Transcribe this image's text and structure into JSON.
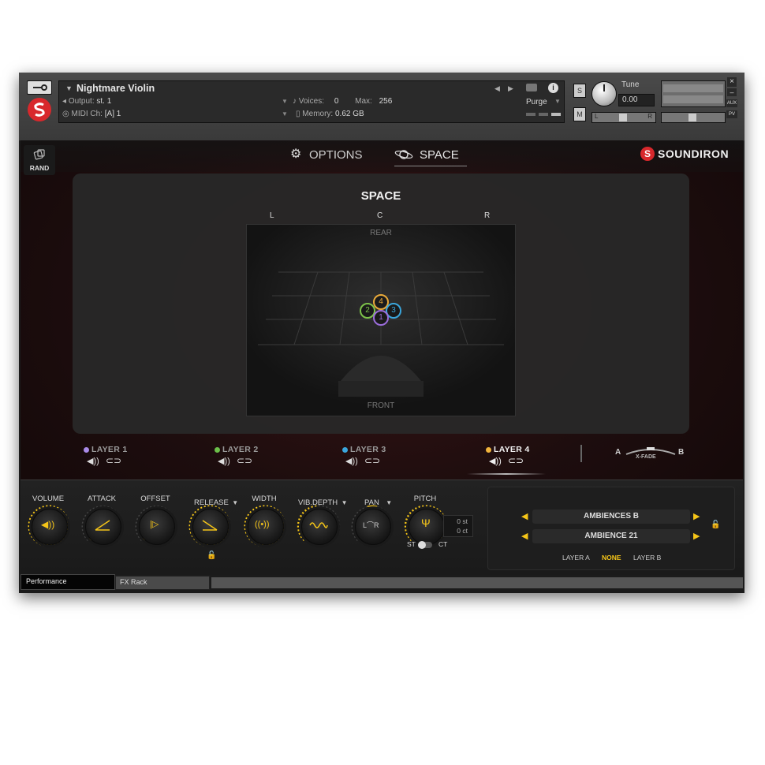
{
  "header": {
    "instrument_name": "Nightmare Violin",
    "output_label": "Output:",
    "output_value": "st. 1",
    "midi_label": "MIDI Ch:",
    "midi_value": "[A] 1",
    "voices_label": "Voices:",
    "voices_value": "0",
    "max_label": "Max:",
    "max_value": "256",
    "memory_label": "Memory:",
    "memory_value": "0.62 GB",
    "purge_label": "Purge",
    "tune_label": "Tune",
    "tune_value": "0.00",
    "solo_label": "S",
    "mute_label": "M",
    "pan_l": "L",
    "pan_r": "R",
    "aux_label": "AUX",
    "pv_label": "PV",
    "close_label": "×",
    "min_label": "–"
  },
  "nav": {
    "rand_label": "RAND",
    "options_tab": "OPTIONS",
    "space_tab": "SPACE",
    "brand": "SOUNDIRON"
  },
  "space": {
    "title": "SPACE",
    "label_l": "L",
    "label_c": "C",
    "label_r": "R",
    "rear": "REAR",
    "front": "FRONT",
    "nodes": [
      {
        "label": "4",
        "color": "#e8a93a"
      },
      {
        "label": "2",
        "color": "#7dc24a"
      },
      {
        "label": "3",
        "color": "#3aa6dd"
      },
      {
        "label": "1",
        "color": "#9b6ddb"
      }
    ]
  },
  "layers": [
    {
      "label": "LAYER 1",
      "color": "#a98be8",
      "active": false
    },
    {
      "label": "LAYER 2",
      "color": "#6cc04a",
      "active": false
    },
    {
      "label": "LAYER 3",
      "color": "#3aa6dd",
      "active": false
    },
    {
      "label": "LAYER 4",
      "color": "#f1b43c",
      "active": true
    }
  ],
  "xfade": {
    "a": "A",
    "b": "B",
    "label": "X-FADE"
  },
  "controls": {
    "volume": "VOLUME",
    "attack": "ATTACK",
    "offset": "OFFSET",
    "release": "RELEASE",
    "width": "WIDTH",
    "vib_depth": "VIB.DEPTH",
    "pan": "PAN",
    "pitch": "PITCH",
    "pitch_st": "0 st",
    "pitch_ct": "0 ct",
    "st": "ST",
    "ct": "CT"
  },
  "ambience": {
    "preset_1": "AMBIENCES B",
    "preset_2": "AMBIENCE 21",
    "layer_a": "LAYER A",
    "none": "NONE",
    "layer_b": "LAYER B"
  },
  "tabs": {
    "performance": "Performance",
    "fx_rack": "FX Rack"
  },
  "colors": {
    "accent": "#f5c518",
    "brand_red": "#d8282c"
  }
}
